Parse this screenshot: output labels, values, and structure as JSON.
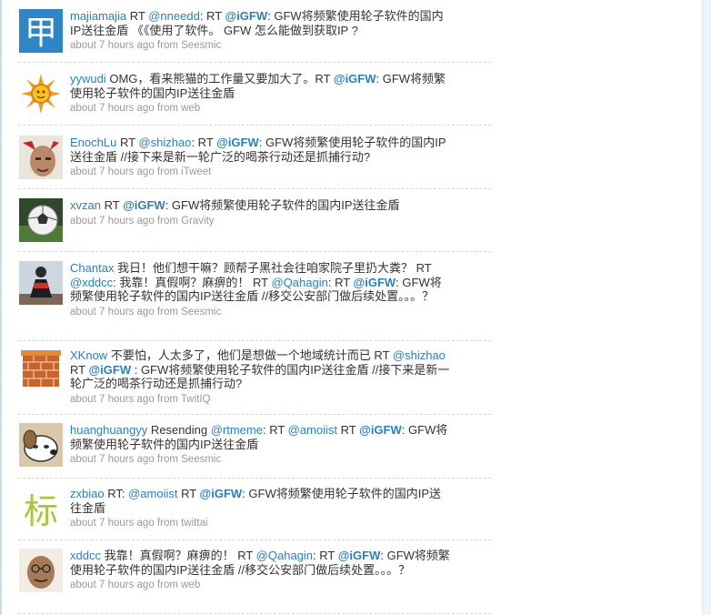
{
  "meta_from": "from",
  "tweets": [
    {
      "user": "majiamajia",
      "parts": [
        {
          "t": "text",
          "v": " RT "
        },
        {
          "t": "mention",
          "v": "@nneedd"
        },
        {
          "t": "text",
          "v": ": RT "
        },
        {
          "t": "hashtag",
          "v": "@iGFW"
        },
        {
          "t": "text",
          "v": ": GFW将频繁使用轮子软件的国内IP送往金盾 《《使用了软件。 GFW 怎么能做到获取IP ?"
        }
      ],
      "time": "about 7 hours ago",
      "source": "Seesmic",
      "avatar": "jia-char"
    },
    {
      "user": "yywudi",
      "parts": [
        {
          "t": "text",
          "v": " OMG，看来熊猫的工作量又要加大了。RT "
        },
        {
          "t": "hashtag",
          "v": "@iGFW"
        },
        {
          "t": "text",
          "v": ": GFW将频繁使用轮子软件的国内IP送往金盾"
        }
      ],
      "time": "about 7 hours ago",
      "source": "web",
      "avatar": "sun"
    },
    {
      "user": "EnochLu",
      "parts": [
        {
          "t": "text",
          "v": " RT "
        },
        {
          "t": "mention",
          "v": "@shizhao"
        },
        {
          "t": "text",
          "v": ": RT "
        },
        {
          "t": "hashtag",
          "v": "@iGFW"
        },
        {
          "t": "text",
          "v": ": GFW将频繁使用轮子软件的国内IP送往金盾 //接下来是新一轮广泛的喝茶行动还是抓捕行动?"
        }
      ],
      "time": "about 7 hours ago",
      "source": "iTweet",
      "avatar": "face"
    },
    {
      "user": "xvzan",
      "parts": [
        {
          "t": "text",
          "v": " RT "
        },
        {
          "t": "hashtag",
          "v": "@iGFW"
        },
        {
          "t": "text",
          "v": ": GFW将频繁使用轮子软件的国内IP送往金盾"
        }
      ],
      "time": "about 7 hours ago",
      "source": "Gravity",
      "avatar": "ball"
    },
    {
      "user": "Chantax",
      "parts": [
        {
          "t": "text",
          "v": " 我日！他们想干嘛？顾帮子黑社会往咱家院子里扔大粪？ RT "
        },
        {
          "t": "mention",
          "v": "@xddcc"
        },
        {
          "t": "text",
          "v": ": 我靠！真假啊？麻痹的！ RT "
        },
        {
          "t": "mention",
          "v": "@Qahagin"
        },
        {
          "t": "text",
          "v": ": RT "
        },
        {
          "t": "hashtag",
          "v": "@iGFW"
        },
        {
          "t": "text",
          "v": ": GFW将频繁使用轮子软件的国内IP送往金盾 //移交公安部门做后续处置。。。？"
        }
      ],
      "time": "about 7 hours ago",
      "source": "Seesmic",
      "avatar": "person"
    },
    {
      "user": "XKnow",
      "parts": [
        {
          "t": "text",
          "v": " 不要怕，人太多了，他们是想做一个地域统计而已 RT "
        },
        {
          "t": "mention",
          "v": "@shizhao"
        },
        {
          "t": "text",
          "v": " RT "
        },
        {
          "t": "hashtag",
          "v": "@iGFW"
        },
        {
          "t": "text",
          "v": " : GFW将频繁使用轮子软件的国内IP送往金盾 //接下来是新一轮广泛的喝茶行动还是抓捕行动?"
        }
      ],
      "time": "about 7 hours ago",
      "source": "TwitIQ",
      "avatar": "wall"
    },
    {
      "user": "huanghuangyy",
      "parts": [
        {
          "t": "text",
          "v": " Resending "
        },
        {
          "t": "mention",
          "v": "@rtmeme"
        },
        {
          "t": "text",
          "v": ": RT "
        },
        {
          "t": "mention",
          "v": "@amoiist"
        },
        {
          "t": "text",
          "v": " RT "
        },
        {
          "t": "hashtag",
          "v": "@iGFW"
        },
        {
          "t": "text",
          "v": ": GFW将频繁使用轮子软件的国内IP送往金盾"
        }
      ],
      "time": "about 7 hours ago",
      "source": "Seesmic",
      "avatar": "dog"
    },
    {
      "user": "zxbiao",
      "parts": [
        {
          "t": "text",
          "v": " RT: "
        },
        {
          "t": "mention",
          "v": "@amoiist"
        },
        {
          "t": "text",
          "v": " RT "
        },
        {
          "t": "hashtag",
          "v": "@iGFW"
        },
        {
          "t": "text",
          "v": ": GFW将频繁使用轮子软件的国内IP送往金盾"
        }
      ],
      "time": "about 7 hours ago",
      "source": "twittai",
      "avatar": "biao-char"
    },
    {
      "user": "xddcc",
      "parts": [
        {
          "t": "text",
          "v": " 我靠！真假啊？麻痹的！ RT "
        },
        {
          "t": "mention",
          "v": "@Qahagin"
        },
        {
          "t": "text",
          "v": ": RT "
        },
        {
          "t": "hashtag",
          "v": "@iGFW"
        },
        {
          "t": "text",
          "v": ": GFW将频繁使用轮子软件的国内IP送往金盾 //移交公安部门做后续处置。。。？"
        }
      ],
      "time": "about 7 hours ago",
      "source": "web",
      "avatar": "gandhi"
    }
  ],
  "avatar_chars": {
    "jia": "甲",
    "biao": "标"
  },
  "colors": {
    "link": "#2e7fb6",
    "meta": "#999999",
    "text": "#333333",
    "jia_bg": "#2f86c7"
  }
}
